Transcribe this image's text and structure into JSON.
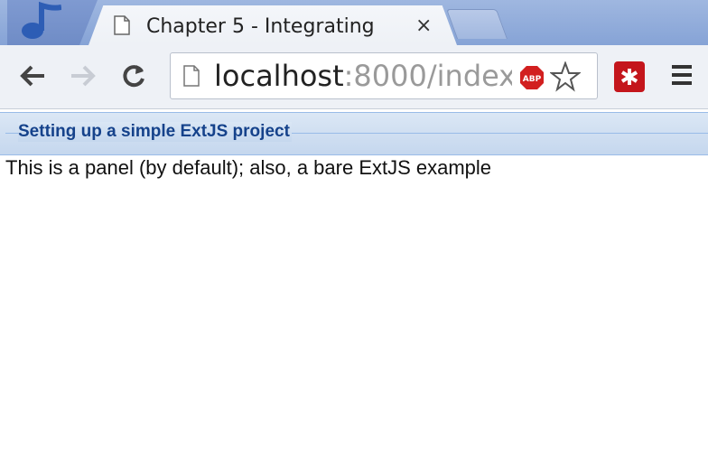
{
  "browser": {
    "tab": {
      "title": "Chapter 5 - Integrating",
      "close_label": "×"
    },
    "toolbar": {
      "url_host": "localhost",
      "url_rest": ":8000/index.",
      "adblock_label": "ABP"
    },
    "icons": {
      "app": "music-note-icon",
      "page": "document-icon",
      "back": "back-arrow-icon",
      "forward": "forward-arrow-icon",
      "reload": "reload-icon",
      "adblock": "adblock-icon",
      "star": "star-icon",
      "extension": "extension-icon",
      "menu": "menu-icon"
    },
    "colors": {
      "tabstrip": "#9fb7e0",
      "panel_title": "#15428b",
      "extension_red": "#c4161c"
    }
  },
  "panel": {
    "title": "Setting up a simple ExtJS project",
    "body": "This is a panel (by default); also, a bare ExtJS example"
  }
}
